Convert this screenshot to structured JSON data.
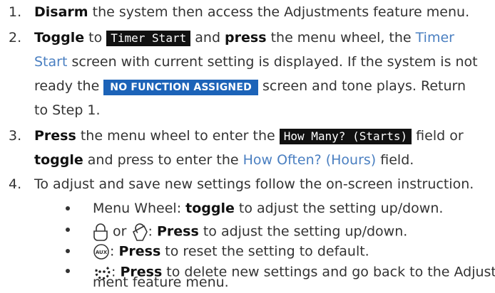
{
  "steps": [
    {
      "num": "1.",
      "line1": {
        "bold": "Disarm",
        "rest": " the system then access the Adjustments feature menu."
      }
    },
    {
      "num": "2.",
      "l1_bold": "Toggle",
      "l1_a": " to ",
      "l1_tag": "Timer Start",
      "l1_b": " and ",
      "l1_bold2": "press",
      "l1_c": " the menu wheel, the ",
      "l1_link": "Timer",
      "l2_link": "Start",
      "l2_a": " screen with current setting is displayed. If the system is not",
      "l3_a": "ready the ",
      "l3_tag": "NO FUNCTION ASSIGNED",
      "l3_b": " screen and tone plays. Return",
      "l4_a": "to Step 1."
    },
    {
      "num": "3.",
      "l1_bold": "Press",
      "l1_a": " the menu wheel to enter the ",
      "l1_tag": "How Many? (Starts)",
      "l1_b": " field or",
      "l2_bold": "toggle",
      "l2_a": " and press to enter the ",
      "l2_link": "How Often? (Hours)",
      "l2_b": " field."
    },
    {
      "num": "4.",
      "line1": "To adjust and save new settings follow the on-screen instruction."
    }
  ],
  "bullets": [
    {
      "pre": "Menu Wheel: ",
      "bold": "toggle",
      "rest": " to adjust the setting up/down."
    },
    {
      "or": "or",
      "sep": ": ",
      "bold": "Press",
      "rest": " to adjust the setting up/down."
    },
    {
      "icon_text": "AUX",
      "sep": ": ",
      "bold": "Press",
      "rest": " to reset the setting to default."
    },
    {
      "sep": ": ",
      "bold": "Press",
      "rest": " to delete new settings and go back to the Adjust-",
      "rest2": "ment feature menu."
    }
  ]
}
